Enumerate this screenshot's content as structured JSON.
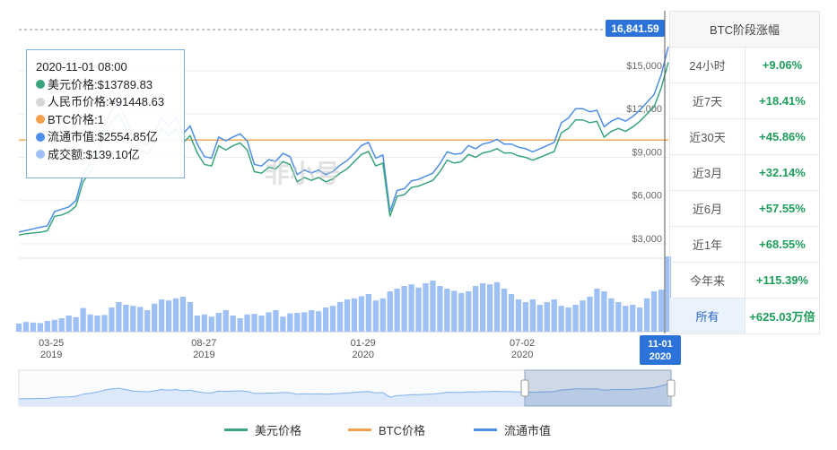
{
  "colors": {
    "usd": "#3aa57d",
    "cny": "#d6d6d6",
    "btc": "#f5a04a",
    "mcap": "#4d8ee8",
    "vol": "#9dc1f5",
    "badge": "#2b73d9"
  },
  "tooltip": {
    "date": "2020-11-01 08:00",
    "rows": [
      {
        "text": "美元价格:$13789.83"
      },
      {
        "text": "人民币价格:¥91448.63"
      },
      {
        "text": "BTC价格:1"
      },
      {
        "text": "流通市值:$2554.85亿"
      },
      {
        "text": "成交额:$139.10亿"
      }
    ]
  },
  "price_badge": "16,841.59",
  "watermark": "非小号",
  "sidebar": {
    "title": "BTC阶段涨幅",
    "rows": [
      {
        "label": "24小时",
        "value": "+9.06%"
      },
      {
        "label": "近7天",
        "value": "+18.41%"
      },
      {
        "label": "近30天",
        "value": "+45.86%"
      },
      {
        "label": "近3月",
        "value": "+32.14%"
      },
      {
        "label": "近6月",
        "value": "+57.55%"
      },
      {
        "label": "近1年",
        "value": "+68.55%"
      },
      {
        "label": "今年来",
        "value": "+115.39%"
      },
      {
        "label": "所有",
        "value": "+625.03万倍"
      }
    ]
  },
  "legend": [
    {
      "name": "美元价格",
      "color": "#3aa57d"
    },
    {
      "name": "BTC价格",
      "color": "#f5a04a"
    },
    {
      "name": "流通市值",
      "color": "#4d8ee8"
    }
  ],
  "chart_data": {
    "type": "line",
    "yticks": [
      "$3,000",
      "$6,000",
      "$9,000",
      "$12,000",
      "$15,000"
    ],
    "ytick_values": [
      3000,
      6000,
      9000,
      12000,
      15000
    ],
    "ylim": [
      2000,
      17800
    ],
    "xticks": [
      {
        "date": "03-25",
        "year": "2019",
        "pos": 0.05
      },
      {
        "date": "08-27",
        "year": "2019",
        "pos": 0.285
      },
      {
        "date": "01-29",
        "year": "2020",
        "pos": 0.53
      },
      {
        "date": "07-02",
        "year": "2020",
        "pos": 0.775
      }
    ],
    "x_highlight": {
      "date": "11-01",
      "year": "2020"
    },
    "btc_line": 10200,
    "usd_price": [
      3600,
      3700,
      3750,
      3800,
      3900,
      4900,
      5000,
      5200,
      5600,
      7300,
      8000,
      9000,
      10500,
      11500,
      12000,
      11000,
      9800,
      9500,
      9200,
      10000,
      11000,
      10500,
      11000,
      10000,
      10500,
      9300,
      8500,
      8400,
      9800,
      9500,
      9800,
      10000,
      9500,
      8000,
      7900,
      8300,
      8200,
      8700,
      8500,
      7300,
      7600,
      7400,
      7600,
      7300,
      7500,
      7900,
      8200,
      8700,
      9200,
      9400,
      8400,
      8600,
      4900,
      6300,
      6400,
      6900,
      7000,
      7200,
      7400,
      8000,
      8800,
      8600,
      8700,
      9200,
      9000,
      9300,
      9400,
      9600,
      9300,
      9300,
      9100,
      9000,
      8800,
      9000,
      9200,
      9400,
      10700,
      11000,
      11600,
      11600,
      11400,
      11500,
      10400,
      10800,
      11000,
      10800,
      11100,
      11500,
      12000,
      12500,
      13800,
      15600
    ],
    "market_cap_yi": [
      700,
      720,
      740,
      760,
      780,
      960,
      990,
      1020,
      1100,
      1430,
      1560,
      1760,
      2050,
      2250,
      2350,
      2150,
      1910,
      1860,
      1800,
      1950,
      2150,
      2050,
      2150,
      1950,
      2050,
      1820,
      1660,
      1640,
      1910,
      1860,
      1910,
      1950,
      1860,
      1560,
      1540,
      1620,
      1600,
      1700,
      1660,
      1430,
      1490,
      1450,
      1490,
      1430,
      1470,
      1550,
      1610,
      1700,
      1800,
      1840,
      1640,
      1680,
      960,
      1230,
      1250,
      1350,
      1370,
      1410,
      1450,
      1570,
      1720,
      1690,
      1700,
      1800,
      1760,
      1820,
      1840,
      1880,
      1820,
      1820,
      1780,
      1760,
      1720,
      1760,
      1800,
      1840,
      2090,
      2150,
      2270,
      2270,
      2230,
      2250,
      2040,
      2110,
      2150,
      2110,
      2170,
      2250,
      2350,
      2450,
      2700,
      3060
    ],
    "volume_yi": [
      15,
      18,
      17,
      16,
      20,
      22,
      25,
      30,
      27,
      44,
      32,
      30,
      31,
      45,
      55,
      50,
      48,
      46,
      40,
      52,
      60,
      58,
      62,
      65,
      55,
      30,
      32,
      28,
      35,
      40,
      30,
      25,
      32,
      33,
      30,
      36,
      40,
      28,
      34,
      35,
      36,
      40,
      38,
      45,
      48,
      55,
      60,
      62,
      66,
      70,
      58,
      62,
      75,
      80,
      85,
      88,
      82,
      90,
      95,
      85,
      80,
      76,
      72,
      75,
      85,
      90,
      88,
      92,
      80,
      70,
      60,
      55,
      60,
      50,
      55,
      60,
      48,
      45,
      50,
      58,
      65,
      80,
      75,
      62,
      55,
      48,
      50,
      45,
      62,
      75,
      78,
      140
    ]
  }
}
